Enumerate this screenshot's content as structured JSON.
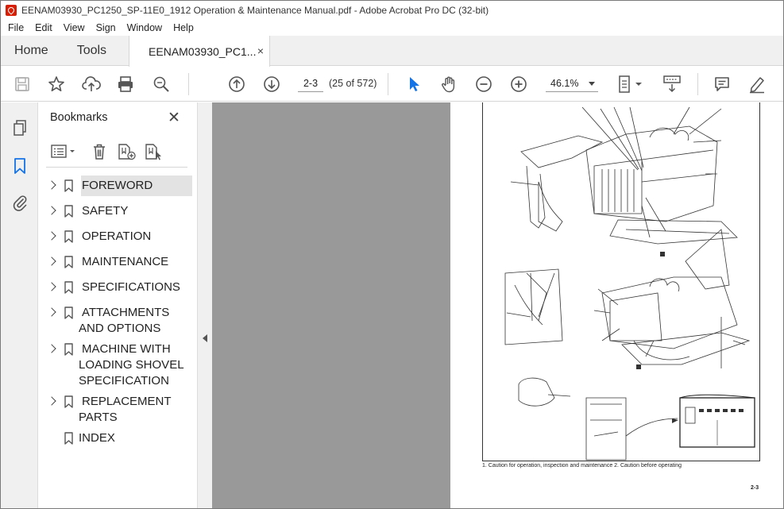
{
  "window": {
    "title": "EENAM03930_PC1250_SP-11E0_1912 Operation & Maintenance Manual.pdf - Adobe Acrobat Pro DC (32-bit)"
  },
  "menu": [
    "File",
    "Edit",
    "View",
    "Sign",
    "Window",
    "Help"
  ],
  "tabs": {
    "home": "Home",
    "tools": "Tools",
    "document": "EENAM03930_PC1...",
    "close": "×"
  },
  "toolbar": {
    "page_input": "2-3",
    "page_count": "(25 of 572)",
    "zoom": "46.1%",
    "icons": [
      "save-icon",
      "star-icon",
      "upload-icon",
      "print-icon",
      "zoom-search-icon",
      "page-up-icon",
      "page-down-icon",
      "select-cursor-icon",
      "hand-icon",
      "zoom-out-icon",
      "zoom-in-icon",
      "fit-page-icon",
      "scroll-mode-icon",
      "comment-icon",
      "sign-pen-icon"
    ]
  },
  "bookmarks": {
    "title": "Bookmarks",
    "close": "✕",
    "items": [
      {
        "label": "FOREWORD",
        "expandable": true,
        "selected": true
      },
      {
        "label": "SAFETY",
        "expandable": true
      },
      {
        "label": "OPERATION",
        "expandable": true
      },
      {
        "label": "MAINTENANCE",
        "expandable": true
      },
      {
        "label": "SPECIFICATIONS",
        "expandable": true
      },
      {
        "label": "ATTACHMENTS\nAND OPTIONS",
        "expandable": true
      },
      {
        "label": "MACHINE WITH\nLOADING SHOVEL\nSPECIFICATION",
        "expandable": true
      },
      {
        "label": "REPLACEMENT\nPARTS",
        "expandable": true
      },
      {
        "label": "INDEX",
        "expandable": false
      }
    ]
  },
  "document_page": {
    "caption": "1. Caution for operation, inspection and maintenance        2. Caution before operating",
    "page_number": "2-3"
  },
  "colors": {
    "accent": "#1473e6",
    "chrome": "#f0f0f0",
    "viewer_bg": "#999999"
  }
}
